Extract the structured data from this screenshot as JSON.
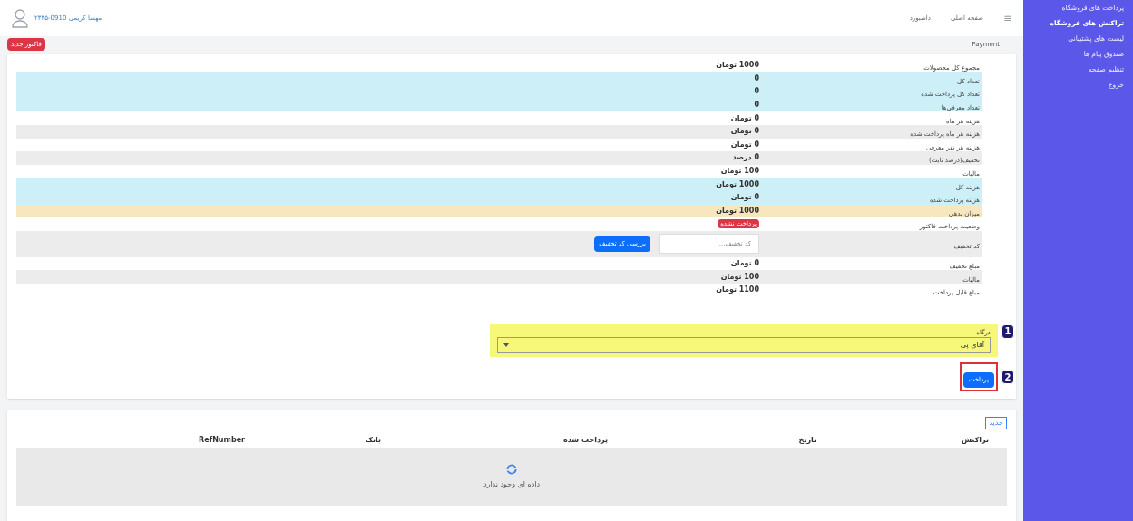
{
  "sidebar": {
    "items": [
      {
        "label": "پرداخت های فروشگاه",
        "selected": false
      },
      {
        "label": "تراکنش های فروشگاه",
        "selected": true
      },
      {
        "label": "لیست های پشتیبانی",
        "selected": false
      },
      {
        "label": "صندوق پیام ها",
        "selected": false
      },
      {
        "label": "تنظیم صفحه",
        "selected": false
      },
      {
        "label": "خروج",
        "selected": false
      }
    ]
  },
  "topbar": {
    "menu_icon": "≡",
    "links": [
      "صفحه اصلی",
      "داشبورد"
    ],
    "user": "مهسا کریمی 0910-۲۳۴۵"
  },
  "page": {
    "title": "Payment",
    "action_button": "فاکتور جدید"
  },
  "invoice": {
    "rows": [
      {
        "label": "مجموع کل محصولات",
        "value": "1000 تومان",
        "kind": "text"
      },
      {
        "label": "تعداد کل",
        "value": "0",
        "color": "#cdeff7",
        "kind": "text"
      },
      {
        "label": "تعداد کل پرداخت شده",
        "value": "0",
        "color": "#cdeff7",
        "kind": "text"
      },
      {
        "label": "تعداد معرفی‌ها",
        "value": "0",
        "color": "#cdeff7",
        "kind": "text"
      },
      {
        "label": "هزینه هر ماه",
        "value": "0 تومان",
        "kind": "text"
      },
      {
        "label": "هزینه هر ماه پرداخت شده",
        "value": "0 تومان",
        "kind": "text"
      },
      {
        "label": "هزینه هر نفر معرفی",
        "value": "0 تومان",
        "kind": "text"
      },
      {
        "label": "تخفیف(درصد ثابت)",
        "value": "0 درصد",
        "kind": "text"
      },
      {
        "label": "مالیات",
        "value": "100 تومان",
        "kind": "text"
      },
      {
        "label": "هزینه کل",
        "value": "1000 تومان",
        "color": "#cdeff7",
        "kind": "text"
      },
      {
        "label": "هزینه پرداخت شده",
        "value": "0 تومان",
        "color": "#cdeff7",
        "kind": "text"
      },
      {
        "label": "میزان بدهی",
        "value": "1000 تومان",
        "color": "#f7e7bf",
        "kind": "text"
      },
      {
        "label": "وضعیت پرداخت فاکتور",
        "value": "پرداخت نشده",
        "kind": "badge"
      },
      {
        "label": "کد تخفیف",
        "placeholder": "کد تخفیف...",
        "button": "بررسی کد تخفیف",
        "kind": "coupon"
      },
      {
        "label": "مبلغ تخفیف",
        "value": "0 تومان",
        "kind": "text"
      },
      {
        "label": "مالیات",
        "value": "100 تومان",
        "kind": "text"
      },
      {
        "label": "مبلغ قابل پرداخت",
        "value": "1100 تومان",
        "kind": "text"
      }
    ]
  },
  "gateway": {
    "label": "درگاه",
    "value": "آقای پی",
    "marker": "1"
  },
  "pay": {
    "button": "پرداخت",
    "marker": "2"
  },
  "transactions": {
    "button": "جدید",
    "columns": [
      "تراکنش",
      "تاریخ",
      "پرداخت شده",
      "بانک",
      "RefNumber"
    ],
    "empty": "داده ای وجود ندارد"
  }
}
